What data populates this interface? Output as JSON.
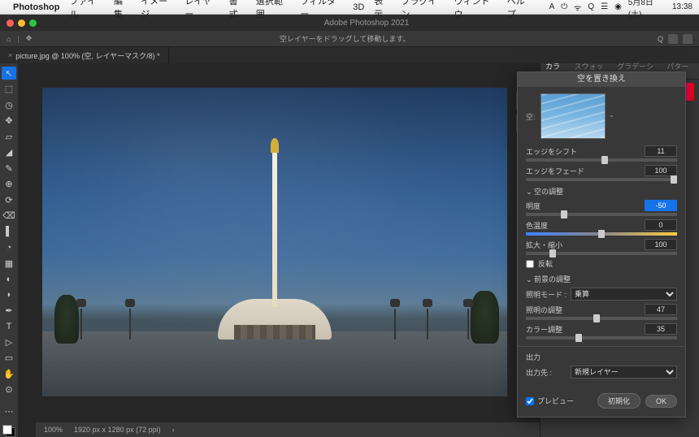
{
  "menubar": {
    "apple": "",
    "items": [
      "Photoshop",
      "ファイル",
      "編集",
      "イメージ",
      "レイヤー",
      "書式",
      "選択範囲",
      "フィルター",
      "3D",
      "表示",
      "プラグイン",
      "ウィンドウ",
      "ヘルプ"
    ],
    "right": {
      "icons": [
        "A",
        "⏻",
        "🔋",
        "⊙",
        "Q",
        "⌨",
        "●"
      ],
      "date": "5月8日(土)",
      "time": "13:38"
    }
  },
  "titlebar": {
    "title": "Adobe Photoshop 2021"
  },
  "optbar": {
    "msg": "空レイヤーをドラッグして移動します。"
  },
  "tab": {
    "label": "picture.jpg @ 100% (空, レイヤーマスク/8) *"
  },
  "status": {
    "zoom": "100%",
    "dims": "1920 px x 1280 px (72 ppi)"
  },
  "panelTabs": [
    "カラー",
    "スウォッチ",
    "グラデーショ",
    "パターン"
  ],
  "dialog": {
    "title": "空を置き換え",
    "skyLabel": "空:",
    "sliders": {
      "edgeShift": {
        "label": "エッジをシフト",
        "value": "11",
        "pos": 52
      },
      "edgeFade": {
        "label": "エッジをフェード",
        "value": "100",
        "pos": 98
      },
      "brightness": {
        "label": "明度",
        "value": "-50",
        "pos": 25,
        "selected": true
      },
      "temperature": {
        "label": "色温度",
        "value": "0",
        "pos": 50,
        "temp": true
      },
      "scale": {
        "label": "拡大・縮小",
        "value": "100",
        "pos": 18
      },
      "lightAdj": {
        "label": "照明の調整",
        "value": "47",
        "pos": 47
      },
      "colorAdj": {
        "label": "カラー調整",
        "value": "35",
        "pos": 35
      }
    },
    "sections": {
      "sky": "空の調整",
      "fg": "前景の調整"
    },
    "flip": "反転",
    "lightMode": {
      "label": "照明モード :",
      "value": "乗算"
    },
    "output": {
      "heading": "出力",
      "label": "出力先 :",
      "value": "新規レイヤー"
    },
    "preview": "プレビュー",
    "reset": "初期化",
    "ok": "OK"
  },
  "tools": [
    "↖",
    "⬚",
    "◷",
    "✥",
    "▱",
    "◢",
    "✎",
    "⊕",
    "⟳",
    "⌫",
    "▌",
    "◔",
    "T",
    "▷",
    "✋",
    "⊙",
    "Q",
    "⊡",
    "⊟"
  ]
}
